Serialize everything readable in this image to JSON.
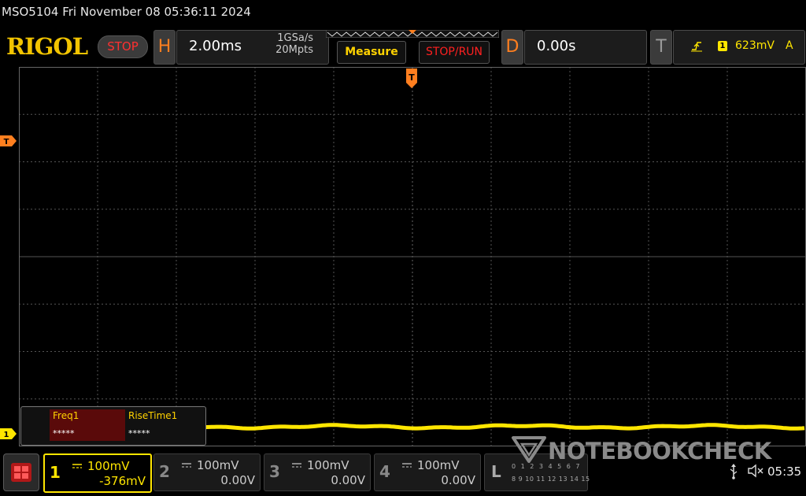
{
  "header": {
    "title_line": "MSO5104  Fri November 08 05:36:11 2024"
  },
  "topbar": {
    "brand": "RIGOL",
    "run_state": "STOP",
    "horizontal": {
      "letter": "H",
      "timebase": "2.00ms",
      "sample_rate": "1GSa/s",
      "memory_depth": "20Mpts"
    },
    "measure_button": "Measure",
    "stoprun_button": "STOP/RUN",
    "delay": {
      "letter": "D",
      "value": "0.00s"
    },
    "trigger": {
      "letter": "T",
      "source": "1",
      "level": "623mV",
      "mode": "A"
    }
  },
  "markers": {
    "trigger_position": "T",
    "trigger_level": "T",
    "channel1": "1"
  },
  "measurements": [
    {
      "label": "Freq1",
      "value": "*****"
    },
    {
      "label": "RiseTime1",
      "value": "*****"
    }
  ],
  "channels": [
    {
      "number": "1",
      "scale": "100mV",
      "offset": "-376mV",
      "active": true
    },
    {
      "number": "2",
      "scale": "100mV",
      "offset": "0.00V",
      "active": false
    },
    {
      "number": "3",
      "scale": "100mV",
      "offset": "0.00V",
      "active": false
    },
    {
      "number": "4",
      "scale": "100mV",
      "offset": "0.00V",
      "active": false
    }
  ],
  "logic": {
    "letter": "L",
    "row1": "0 1 2 3 4 5 6 7",
    "row2": "8 9 10 11 12 13 14 15"
  },
  "watermark": "NOTEBOOKCHECK",
  "status": {
    "time": "05:35"
  },
  "colors": {
    "ch1": "#ffe600",
    "accent_orange": "#ff7f1f",
    "brand": "#f2c400",
    "stop_red": "#ff2020",
    "grid": "#555555"
  },
  "icons": [
    "menu-grid-icon",
    "trigger-slope-rising-icon",
    "usb-icon",
    "speaker-muted-icon",
    "notebookcheck-logo-icon"
  ]
}
